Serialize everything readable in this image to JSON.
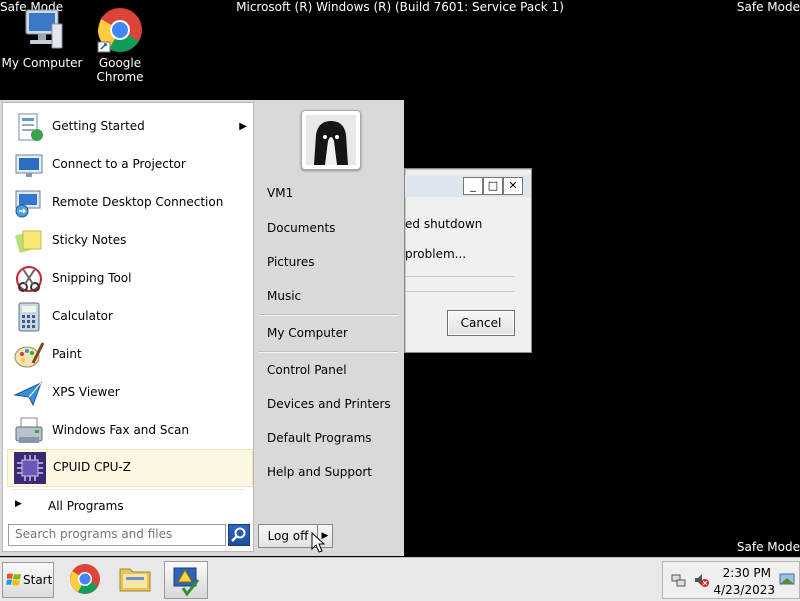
{
  "screen": {
    "safe_mode": "Safe Mode",
    "build": "Microsoft (R) Windows (R) (Build 7601: Service Pack 1)"
  },
  "desktop_icons": [
    {
      "label": "My Computer",
      "icon": "computer-icon"
    },
    {
      "label_line1": "Google",
      "label_line2": "Chrome",
      "icon": "chrome-icon"
    }
  ],
  "dialog": {
    "line1": "ed shutdown",
    "line2": "problem...",
    "cancel_label": "Cancel",
    "min_glyph": "_",
    "max_glyph": "□",
    "close_glyph": "✕"
  },
  "start_menu": {
    "programs": [
      {
        "label": "Getting Started",
        "icon": "getting-started-icon",
        "has_submenu": true
      },
      {
        "label": "Connect to a Projector",
        "icon": "projector-icon"
      },
      {
        "label": "Remote Desktop Connection",
        "icon": "remote-desktop-icon"
      },
      {
        "label": "Sticky Notes",
        "icon": "sticky-notes-icon"
      },
      {
        "label": "Snipping Tool",
        "icon": "snipping-tool-icon"
      },
      {
        "label": "Calculator",
        "icon": "calculator-icon"
      },
      {
        "label": "Paint",
        "icon": "paint-icon"
      },
      {
        "label": "XPS Viewer",
        "icon": "xps-viewer-icon"
      },
      {
        "label": "Windows Fax and Scan",
        "icon": "fax-scan-icon"
      },
      {
        "label": "CPUID CPU-Z",
        "icon": "cpuz-icon"
      }
    ],
    "submenu_arrow": "▶",
    "all_programs": "All Programs",
    "all_programs_arrow": "▶",
    "search_placeholder": "Search programs and files",
    "places": [
      "VM1",
      "Documents",
      "Pictures",
      "Music",
      "My Computer",
      "Control Panel",
      "Devices and Printers",
      "Default Programs",
      "Help and Support"
    ],
    "logoff_label": "Log off",
    "logoff_arrow": "▶"
  },
  "taskbar": {
    "start_label": "Start",
    "time": "2:30 PM",
    "date": "4/23/2023"
  }
}
